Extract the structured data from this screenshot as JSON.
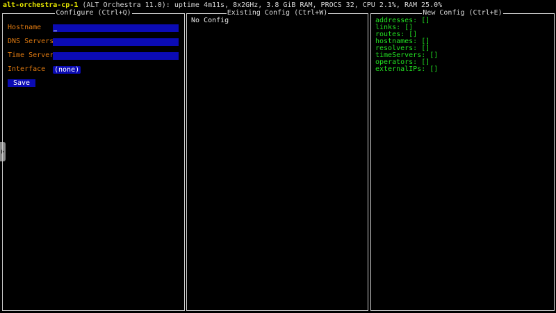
{
  "status_bar": {
    "host": "alt-orchestra-cp-1",
    "info": "(ALT Orchestra 11.0): uptime 4m11s, 8x2GHz, 3.8 GiB RAM, PROCS 32, CPU 2.1%, RAM 25.0%"
  },
  "panels": {
    "configure": {
      "title": "Configure (Ctrl+Q)",
      "fields": [
        {
          "label": "Hostname",
          "value": ""
        },
        {
          "label": "DNS Servers",
          "value": ""
        },
        {
          "label": "Time Servers",
          "value": ""
        }
      ],
      "interface": {
        "label": "Interface",
        "value": "(none)"
      },
      "save_label": "Save"
    },
    "existing": {
      "title": "Existing Config (Ctrl+W)",
      "text": "No Config"
    },
    "new": {
      "title": "New Config (Ctrl+E)",
      "items": [
        "addresses: []",
        "links: []",
        "routes: []",
        "hostnames: []",
        "resolvers: []",
        "timeServers: []",
        "operators: []",
        "externalIPs: []"
      ]
    }
  },
  "side_tab": {
    "icon": "chevron-right-icon"
  },
  "colors": {
    "background": "#000000",
    "host": "#e8e800",
    "label": "#e07a10",
    "field_bg": "#0b0bb4",
    "list_text": "#22e022",
    "border": "#cfcfcf"
  }
}
